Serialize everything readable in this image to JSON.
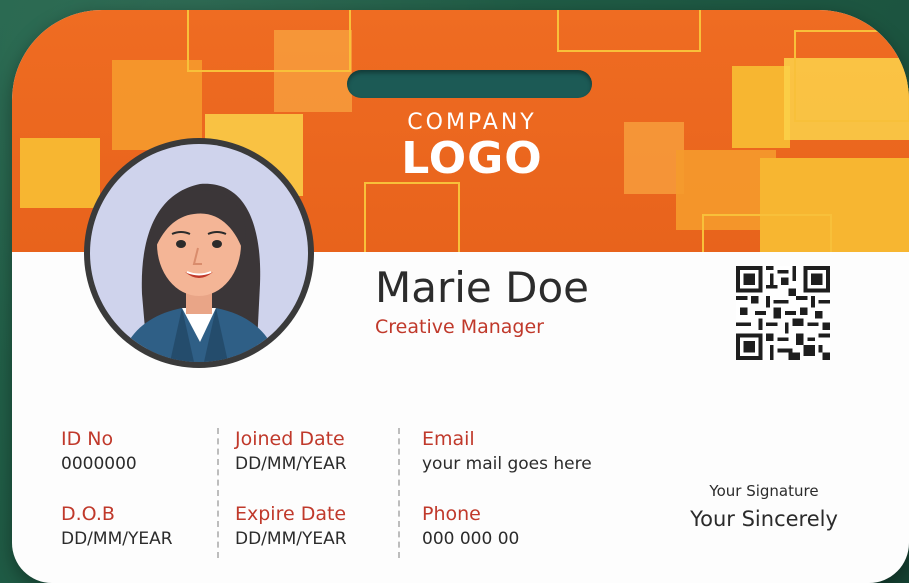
{
  "card": {
    "logo_company": "COMPANY",
    "logo_main": "LOGO",
    "name": "Marie Doe",
    "job_title": "Creative Manager",
    "avatar_icon": "woman-avatar-icon",
    "qr_icon": "qr-code-icon"
  },
  "fields": {
    "id_label": "ID No",
    "id_value": "0000000",
    "dob_label": "D.O.B",
    "dob_value": "DD/MM/YEAR",
    "joined_label": "Joined Date",
    "joined_value": "DD/MM/YEAR",
    "expire_label": "Expire Date",
    "expire_value": "DD/MM/YEAR",
    "email_label": "Email",
    "email_value": "your mail goes here",
    "phone_label": "Phone",
    "phone_value": "000 000 00"
  },
  "signature": {
    "label": "Your Signature",
    "value": "Your Sincerely"
  },
  "colors": {
    "header_orange": "#e8631c",
    "accent_yellow": "#f7b631",
    "label_red": "#c0392b",
    "slot_teal": "#1c5a55",
    "background_green": "#1f5b45"
  }
}
